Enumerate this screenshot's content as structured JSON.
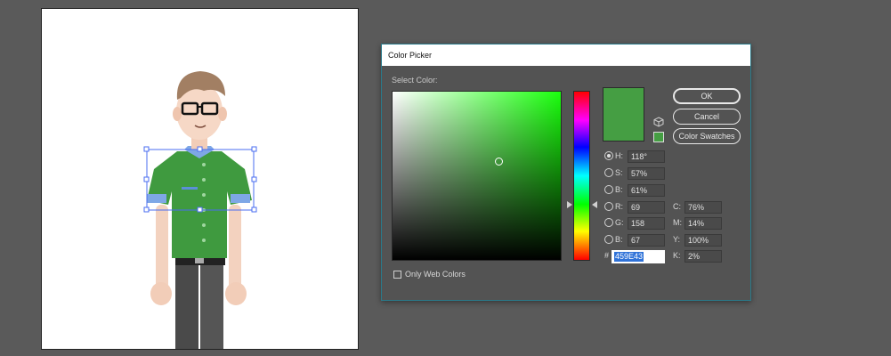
{
  "dialog": {
    "title": "Color Picker",
    "select_label": "Select Color:",
    "buttons": {
      "ok": "OK",
      "cancel": "Cancel",
      "swatches": "Color Swatches"
    },
    "current_color": "#459E43",
    "hue_color": "#1aff0d",
    "hsb": [
      {
        "label": "H:",
        "value": "118°",
        "checked": true
      },
      {
        "label": "S:",
        "value": "57%",
        "checked": false
      },
      {
        "label": "B:",
        "value": "61%",
        "checked": false
      }
    ],
    "rgb": [
      {
        "label": "R:",
        "value": "69"
      },
      {
        "label": "G:",
        "value": "158"
      },
      {
        "label": "B:",
        "value": "67"
      }
    ],
    "cmyk": [
      {
        "label": "C:",
        "value": "76%"
      },
      {
        "label": "M:",
        "value": "14%"
      },
      {
        "label": "Y:",
        "value": "100%"
      },
      {
        "label": "K:",
        "value": "2%"
      }
    ],
    "hex": {
      "label": "#",
      "value": "459E43"
    },
    "only_web_colors": "Only Web Colors",
    "icons": [
      "cube-icon",
      "radio-icon",
      "checkbox-icon"
    ]
  },
  "artboard": {
    "shirt_color": "#3f9a3f",
    "icons": [
      "character-illustration",
      "selection-bounding-box"
    ]
  }
}
